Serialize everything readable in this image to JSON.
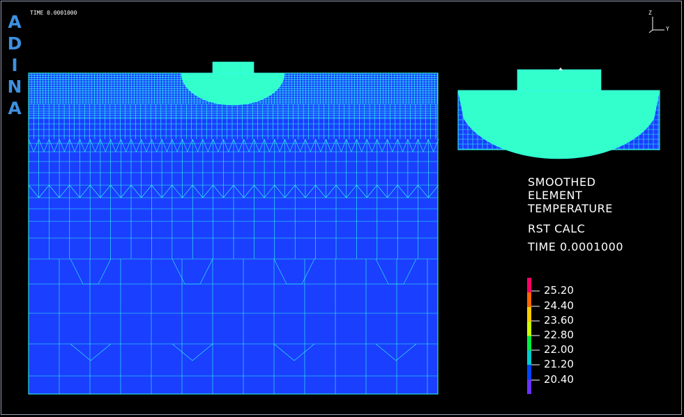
{
  "window": {
    "logo_letters": [
      "A",
      "D",
      "I",
      "N",
      "A"
    ],
    "time_small": "TIME 0.0001000"
  },
  "axes": {
    "z_label": "Z",
    "y_label": "Y"
  },
  "legend": {
    "title_lines": [
      "SMOOTHED",
      "ELEMENT",
      "TEMPERATURE"
    ],
    "rst_label": "RST CALC",
    "time_label": "TIME 0.0001000",
    "ticks": [
      "25.20",
      "24.40",
      "23.60",
      "22.80",
      "22.00",
      "21.20",
      "20.40"
    ],
    "colors": [
      "#ff0066",
      "#ff6600",
      "#ffcc00",
      "#ccff00",
      "#00ee44",
      "#00cccc",
      "#0044ff",
      "#6633ff"
    ]
  },
  "colors": {
    "background": "#000000",
    "mesh_fill": "#1a3fff",
    "mesh_line": "#33ffee",
    "hot_fill": "#33ffcc",
    "logo": "#3f8fe0"
  }
}
